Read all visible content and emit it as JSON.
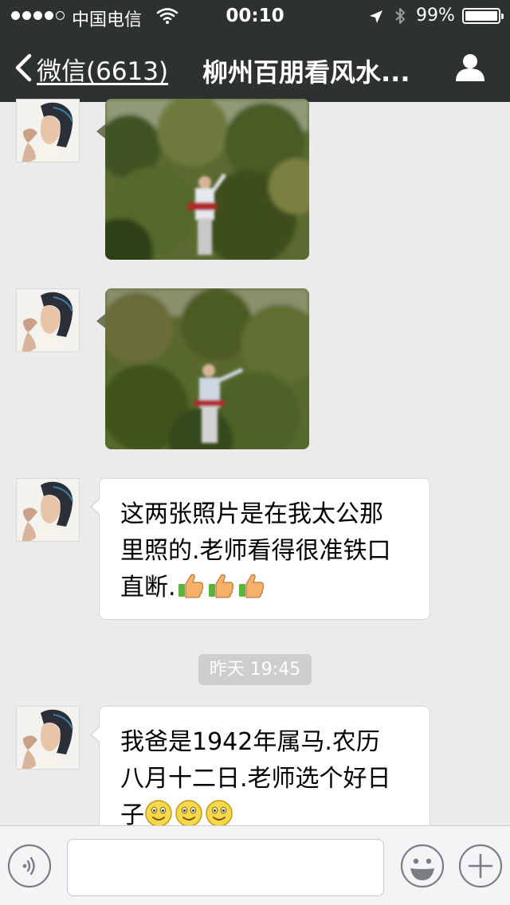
{
  "status_bar": {
    "carrier": "中国电信",
    "time": "00:10",
    "battery_percent": "99%",
    "battery_level": 0.99,
    "signal_bars": 4
  },
  "nav": {
    "back_label": "微信(6613)",
    "title": "柳州百朋看风水...",
    "icons": [
      "chevron-left-icon",
      "person-icon"
    ]
  },
  "messages": [
    {
      "type": "image",
      "description": "photo"
    },
    {
      "type": "image",
      "description": "photo"
    },
    {
      "type": "text",
      "lines": [
        "这两张照片是在我太公那",
        "里照的.老师看得很准铁口",
        "直断."
      ],
      "emoji": [
        "thumbs-up-icon",
        "thumbs-up-icon",
        "thumbs-up-icon"
      ]
    },
    {
      "type": "timestamp",
      "text": "昨天 19:45"
    },
    {
      "type": "text",
      "lines": [
        "我爸是1942年属马.农历",
        "八月十二日.老师选个好日",
        "子"
      ],
      "emoji": [
        "smile-icon",
        "smile-icon",
        "smile-icon"
      ]
    }
  ],
  "input_bar": {
    "placeholder": "",
    "icons": [
      "voice-icon",
      "emoji-face-icon",
      "plus-icon"
    ]
  },
  "colors": {
    "nav_background": "#2e3132",
    "chat_background": "#ebebeb",
    "bubble_background": "#ffffff",
    "timestamp_background": "#cecece"
  }
}
